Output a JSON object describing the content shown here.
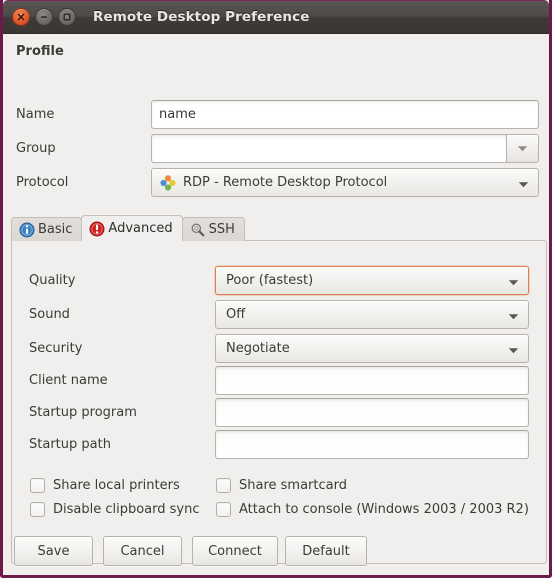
{
  "window": {
    "title": "Remote Desktop Preference",
    "controls": [
      {
        "name": "close-button",
        "glyph": "close-icon"
      },
      {
        "name": "minimize-button",
        "glyph": "minimize-icon"
      },
      {
        "name": "maximize-button",
        "glyph": "maximize-icon"
      }
    ]
  },
  "profile": {
    "section_label": "Profile",
    "name": {
      "label": "Name",
      "value": "name"
    },
    "group": {
      "label": "Group",
      "value": ""
    },
    "protocol": {
      "label": "Protocol",
      "value": "RDP - Remote Desktop Protocol",
      "icon": "rdp-protocol-icon"
    }
  },
  "tabs": [
    {
      "label": "Basic",
      "icon": "info-icon",
      "active": false
    },
    {
      "label": "Advanced",
      "icon": "warning-icon",
      "active": true
    },
    {
      "label": "SSH",
      "icon": "key-search-icon",
      "active": false
    }
  ],
  "advanced": {
    "quality": {
      "label": "Quality",
      "value": "Poor (fastest)",
      "focused": true
    },
    "sound": {
      "label": "Sound",
      "value": "Off"
    },
    "security": {
      "label": "Security",
      "value": "Negotiate"
    },
    "client_name": {
      "label": "Client name",
      "value": ""
    },
    "startup_program": {
      "label": "Startup program",
      "value": ""
    },
    "startup_path": {
      "label": "Startup path",
      "value": ""
    },
    "checkboxes": [
      {
        "label": "Share local printers",
        "checked": false
      },
      {
        "label": "Share smartcard",
        "checked": false
      },
      {
        "label": "Disable clipboard sync",
        "checked": false
      },
      {
        "label": "Attach to console (Windows 2003 / 2003 R2)",
        "checked": false
      }
    ]
  },
  "actions": [
    {
      "label": "Save"
    },
    {
      "label": "Cancel"
    },
    {
      "label": "Connect"
    },
    {
      "label": "Default"
    }
  ],
  "colors": {
    "window_border": "#6d1a4a",
    "titlebar": "#45413e",
    "background": "#f0efee",
    "focus_orange": "#e0814f",
    "close_button": "#e2572a"
  }
}
